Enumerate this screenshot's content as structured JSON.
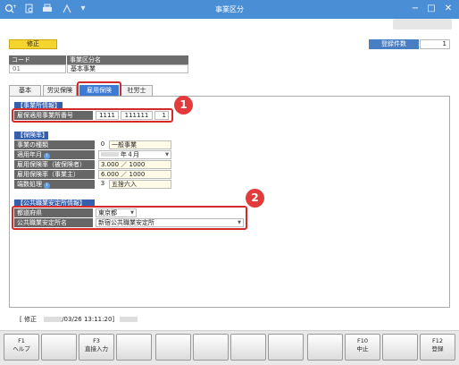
{
  "window": {
    "title": "事業区分",
    "toolbar_icons": [
      "add-icon",
      "search-icon",
      "print-icon",
      "export-icon",
      "menu-dropdown-icon"
    ],
    "controls": {
      "minimize": "−",
      "maximize": "□",
      "close": "✕"
    }
  },
  "header": {
    "status": "修正",
    "count_label": "登録件数",
    "count_value": "1",
    "code_label": "コード",
    "name_label": "事業区分名",
    "code_value": "01",
    "name_value": "基本事業"
  },
  "tabs": [
    {
      "label": "基本"
    },
    {
      "label": "労災保険"
    },
    {
      "label": "雇用保険"
    },
    {
      "label": "社労士"
    }
  ],
  "office_section": {
    "title": "【事業所情報】",
    "row_label": "雇保適用事業所番号",
    "num1": "1111",
    "num2": "111111",
    "num3": "1"
  },
  "rate_section": {
    "title": "【保険率】",
    "rows": [
      {
        "label": "事業の種類",
        "code": "0",
        "value": "一般事業"
      },
      {
        "label": "適用年月",
        "value": "年４月"
      },
      {
        "label": "雇用保険率（被保険者）",
        "value": "3.000 ／ 1000"
      },
      {
        "label": "雇用保険率（事業主）",
        "value": "6.000 ／ 1000"
      },
      {
        "label": "端数処理",
        "code": "3",
        "value": "五捨六入"
      }
    ]
  },
  "employment_section": {
    "title": "【公共職業安定所情報】",
    "prefecture_label": "都道府県",
    "prefecture_value": "東京都",
    "office_label": "公共職業安定所名",
    "office_value": "新宿公共職業安定所"
  },
  "callouts": {
    "one": "1",
    "two": "2"
  },
  "status_line": {
    "mode": "[ 修正",
    "datetime": "/03/26 13:11:20]"
  },
  "function_keys": [
    {
      "key": "F1",
      "label": "ヘルプ"
    },
    {
      "key": "",
      "label": ""
    },
    {
      "key": "F3",
      "label": "直接入力"
    },
    {
      "key": "",
      "label": ""
    },
    {
      "key": "",
      "label": ""
    },
    {
      "key": "",
      "label": ""
    },
    {
      "key": "",
      "label": ""
    },
    {
      "key": "",
      "label": ""
    },
    {
      "key": "",
      "label": ""
    },
    {
      "key": "F10",
      "label": "中止"
    },
    {
      "key": "",
      "label": ""
    },
    {
      "key": "F12",
      "label": "登録"
    }
  ],
  "colors": {
    "titlebar": "#4a8fd6",
    "status_badge": "#f6d430",
    "section_header": "#3560b0",
    "label_bg": "#666666",
    "highlight": "#d32a2a"
  }
}
